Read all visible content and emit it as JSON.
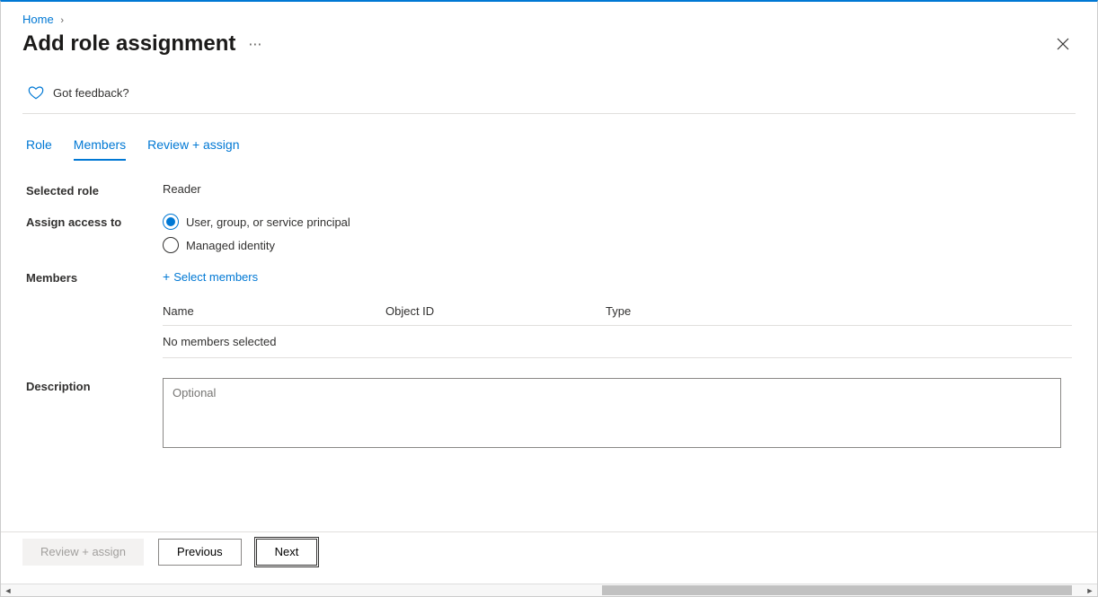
{
  "breadcrumb": {
    "home": "Home"
  },
  "page": {
    "title": "Add role assignment"
  },
  "feedback": {
    "label": "Got feedback?"
  },
  "tabs": {
    "role": "Role",
    "members": "Members",
    "review": "Review + assign"
  },
  "form": {
    "selected_role_label": "Selected role",
    "selected_role_value": "Reader",
    "assign_access_label": "Assign access to",
    "radio_user": "User, group, or service principal",
    "radio_managed": "Managed identity",
    "members_label": "Members",
    "select_members": "Select members",
    "table_name": "Name",
    "table_object": "Object ID",
    "table_type": "Type",
    "table_empty": "No members selected",
    "description_label": "Description",
    "description_placeholder": "Optional"
  },
  "footer": {
    "review": "Review + assign",
    "previous": "Previous",
    "next": "Next"
  }
}
